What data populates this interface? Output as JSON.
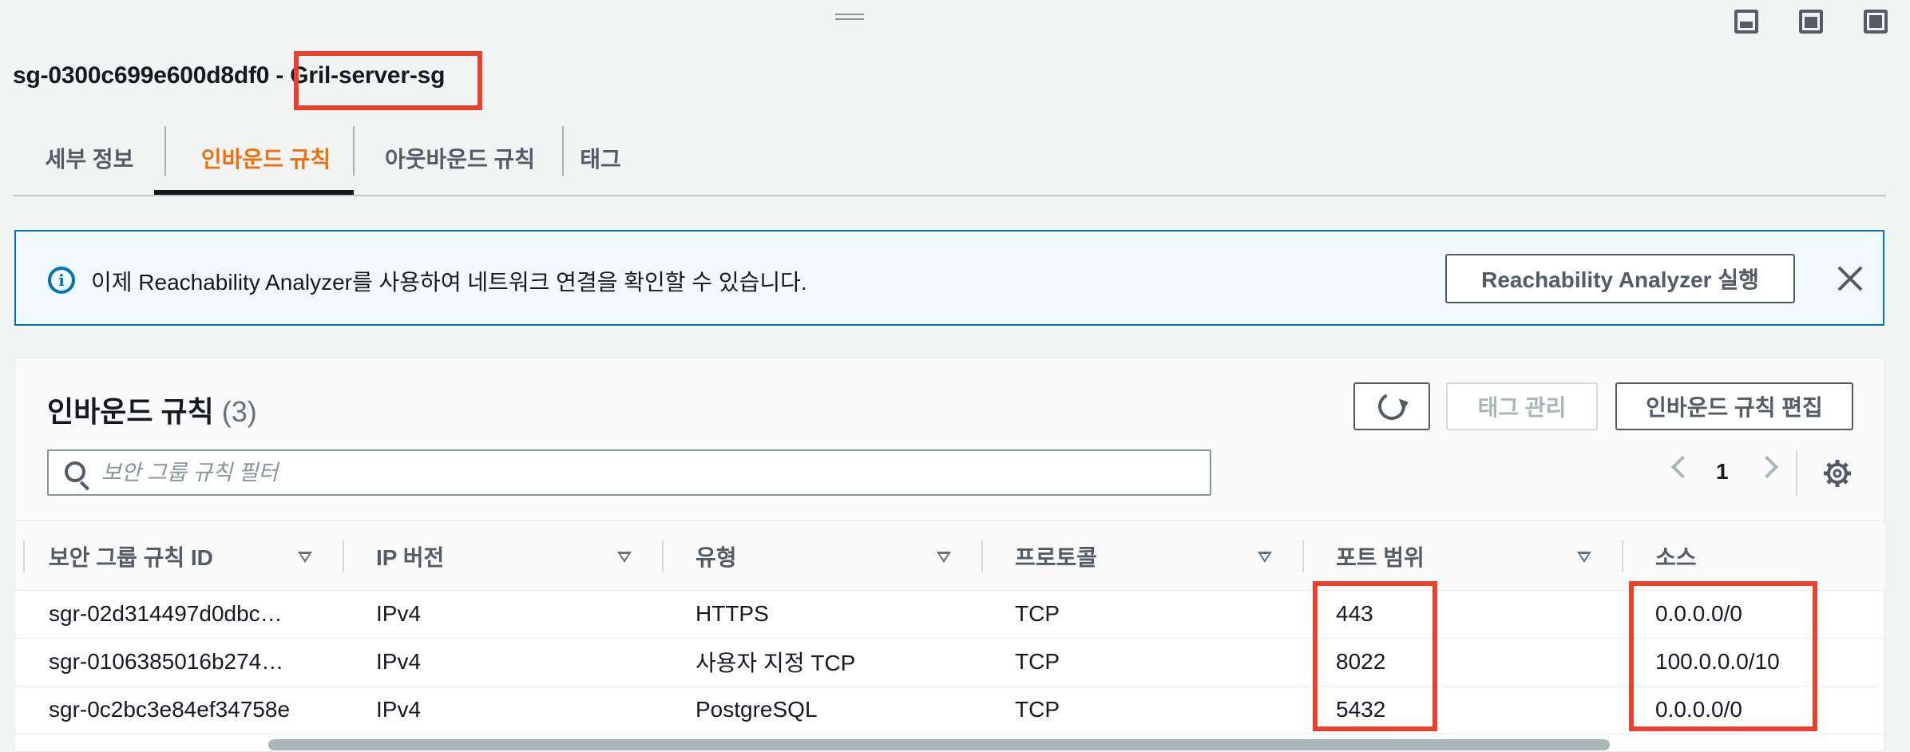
{
  "header": {
    "sg_id": "sg-0300c699e600d8df0 -",
    "sg_name": "Gril-server-sg"
  },
  "tabs": [
    {
      "label": "세부 정보",
      "active": false
    },
    {
      "label": "인바운드 규칙",
      "active": true
    },
    {
      "label": "아웃바운드 규칙",
      "active": false
    },
    {
      "label": "태그",
      "active": false
    }
  ],
  "flash": {
    "message": "이제 Reachability Analyzer를 사용하여 네트워크 연결을 확인할 수 있습니다.",
    "button_label": "Reachability Analyzer 실행"
  },
  "rules_panel": {
    "title": "인바운드 규칙",
    "count": "(3)",
    "manage_tags_label": "태그 관리",
    "edit_rules_label": "인바운드 규칙 편집",
    "search_placeholder": "보안 그룹 규칙 필터",
    "page": "1"
  },
  "table": {
    "columns": [
      "보안 그룹 규칙 ID",
      "IP 버전",
      "유형",
      "프로토콜",
      "포트 범위",
      "소스"
    ],
    "rows": [
      [
        "sgr-02d314497d0dbc…",
        "IPv4",
        "HTTPS",
        "TCP",
        "443",
        "0.0.0.0/0"
      ],
      [
        "sgr-0106385016b274…",
        "IPv4",
        "사용자 지정 TCP",
        "TCP",
        "8022",
        "100.0.0.0/10"
      ],
      [
        "sgr-0c2bc3e84ef34758e",
        "IPv4",
        "PostgreSQL",
        "TCP",
        "5432",
        "0.0.0.0/0"
      ]
    ]
  },
  "colors": {
    "accent": "#ec7211",
    "info_blue": "#0073bb",
    "highlight_red": "#e8412c"
  }
}
